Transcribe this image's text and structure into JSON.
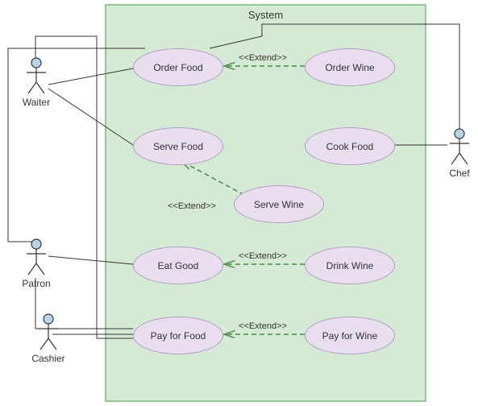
{
  "system": {
    "title": "System"
  },
  "actors": {
    "waiter": "Waiter",
    "chef": "Chef",
    "patron": "Patron",
    "cashier": "Cashier"
  },
  "usecases": {
    "order_food": "Order Food",
    "order_wine": "Order Wine",
    "serve_food": "Serve Food",
    "cook_food": "Cook Food",
    "serve_wine": "Serve Wine",
    "eat_good": "Eat Good",
    "drink_wine": "Drink Wine",
    "pay_for_food": "Pay for Food",
    "pay_for_wine": "Pay for Wine"
  },
  "stereotypes": {
    "extend1": "<<Extend>>",
    "extend2": "<<Extend>>",
    "extend3": "<<Extend>>",
    "extend4": "<<Extend>>"
  },
  "chart_data": {
    "type": "uml-use-case",
    "system": "System",
    "actors": [
      "Waiter",
      "Chef",
      "Patron",
      "Cashier"
    ],
    "use_cases": [
      "Order Food",
      "Order Wine",
      "Serve Food",
      "Cook Food",
      "Serve Wine",
      "Eat Good",
      "Drink Wine",
      "Pay for Food",
      "Pay for Wine"
    ],
    "associations": [
      {
        "actor": "Waiter",
        "use_case": "Order Food"
      },
      {
        "actor": "Waiter",
        "use_case": "Serve Food"
      },
      {
        "actor": "Waiter",
        "use_case": "Pay for Food"
      },
      {
        "actor": "Chef",
        "use_case": "Order Food"
      },
      {
        "actor": "Chef",
        "use_case": "Cook Food"
      },
      {
        "actor": "Patron",
        "use_case": "Order Food"
      },
      {
        "actor": "Patron",
        "use_case": "Eat Good"
      },
      {
        "actor": "Patron",
        "use_case": "Pay for Food"
      },
      {
        "actor": "Cashier",
        "use_case": "Pay for Food"
      }
    ],
    "extends": [
      {
        "from": "Order Wine",
        "to": "Order Food"
      },
      {
        "from": "Serve Wine",
        "to": "Serve Food"
      },
      {
        "from": "Drink Wine",
        "to": "Eat Good"
      },
      {
        "from": "Pay for Wine",
        "to": "Pay for Food"
      }
    ]
  }
}
